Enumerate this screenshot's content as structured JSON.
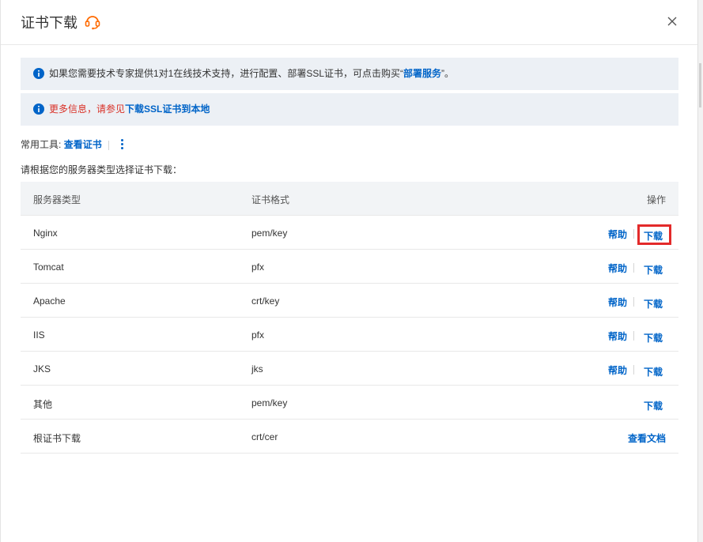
{
  "dialog": {
    "title": "证书下载",
    "close_label": "×"
  },
  "notices": {
    "deploy": {
      "prefix": "如果您需要技术专家提供1对1在线技术支持，进行配置、部署SSL证书，可点击购买“",
      "link": "部署服务",
      "suffix": "”。"
    },
    "more_info": {
      "prefix": "更多信息，请参见",
      "link": "下载SSL证书到本地"
    }
  },
  "tools": {
    "label": "常用工具:",
    "view_cert": "查看证书"
  },
  "instruction": "请根据您的服务器类型选择证书下载：",
  "table": {
    "headers": {
      "server_type": "服务器类型",
      "cert_format": "证书格式",
      "action": "操作"
    },
    "rows": [
      {
        "server": "Nginx",
        "format": "pem/key",
        "help": "帮助",
        "download": "下载"
      },
      {
        "server": "Tomcat",
        "format": "pfx",
        "help": "帮助",
        "download": "下载"
      },
      {
        "server": "Apache",
        "format": "crt/key",
        "help": "帮助",
        "download": "下载"
      },
      {
        "server": "IIS",
        "format": "pfx",
        "help": "帮助",
        "download": "下载"
      },
      {
        "server": "JKS",
        "format": "jks",
        "help": "帮助",
        "download": "下载"
      },
      {
        "server": "其他",
        "format": "pem/key",
        "download": "下载"
      },
      {
        "server": "根证书下载",
        "format": "crt/cer",
        "doc": "查看文档"
      }
    ]
  },
  "colors": {
    "link": "#0064c8",
    "notice_bg": "#ecf0f5",
    "warning_text": "#d93026",
    "highlight_box": "#e32a2a",
    "headset_icon": "#ff6a00"
  },
  "icons": [
    "headset-icon",
    "close-icon",
    "info-icon",
    "more-vertical-icon"
  ]
}
